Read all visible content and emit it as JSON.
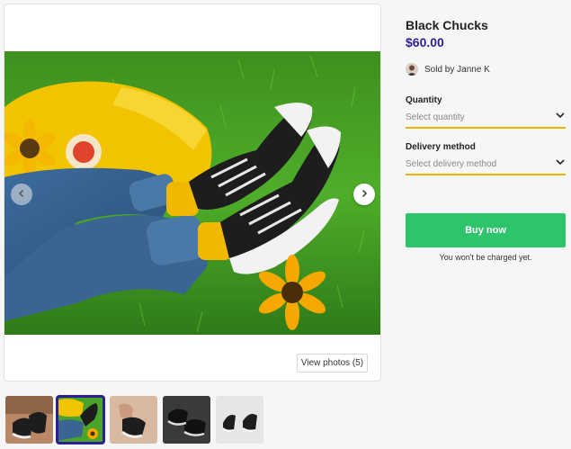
{
  "product": {
    "title": "Black Chucks",
    "price": "$60.00",
    "seller_text": "Sold by Janne K"
  },
  "quantity": {
    "label": "Quantity",
    "placeholder": "Select quantity"
  },
  "delivery": {
    "label": "Delivery method",
    "placeholder": "Select delivery method"
  },
  "actions": {
    "buy_label": "Buy now",
    "note": "You won't be charged yet.",
    "view_photos_label": "View photos (5)"
  },
  "gallery": {
    "photo_count": 5,
    "selected_index": 1
  },
  "colors": {
    "accent": "#2c1f8f",
    "buy_button": "#2dc46c",
    "select_underline": "#f0b400"
  }
}
